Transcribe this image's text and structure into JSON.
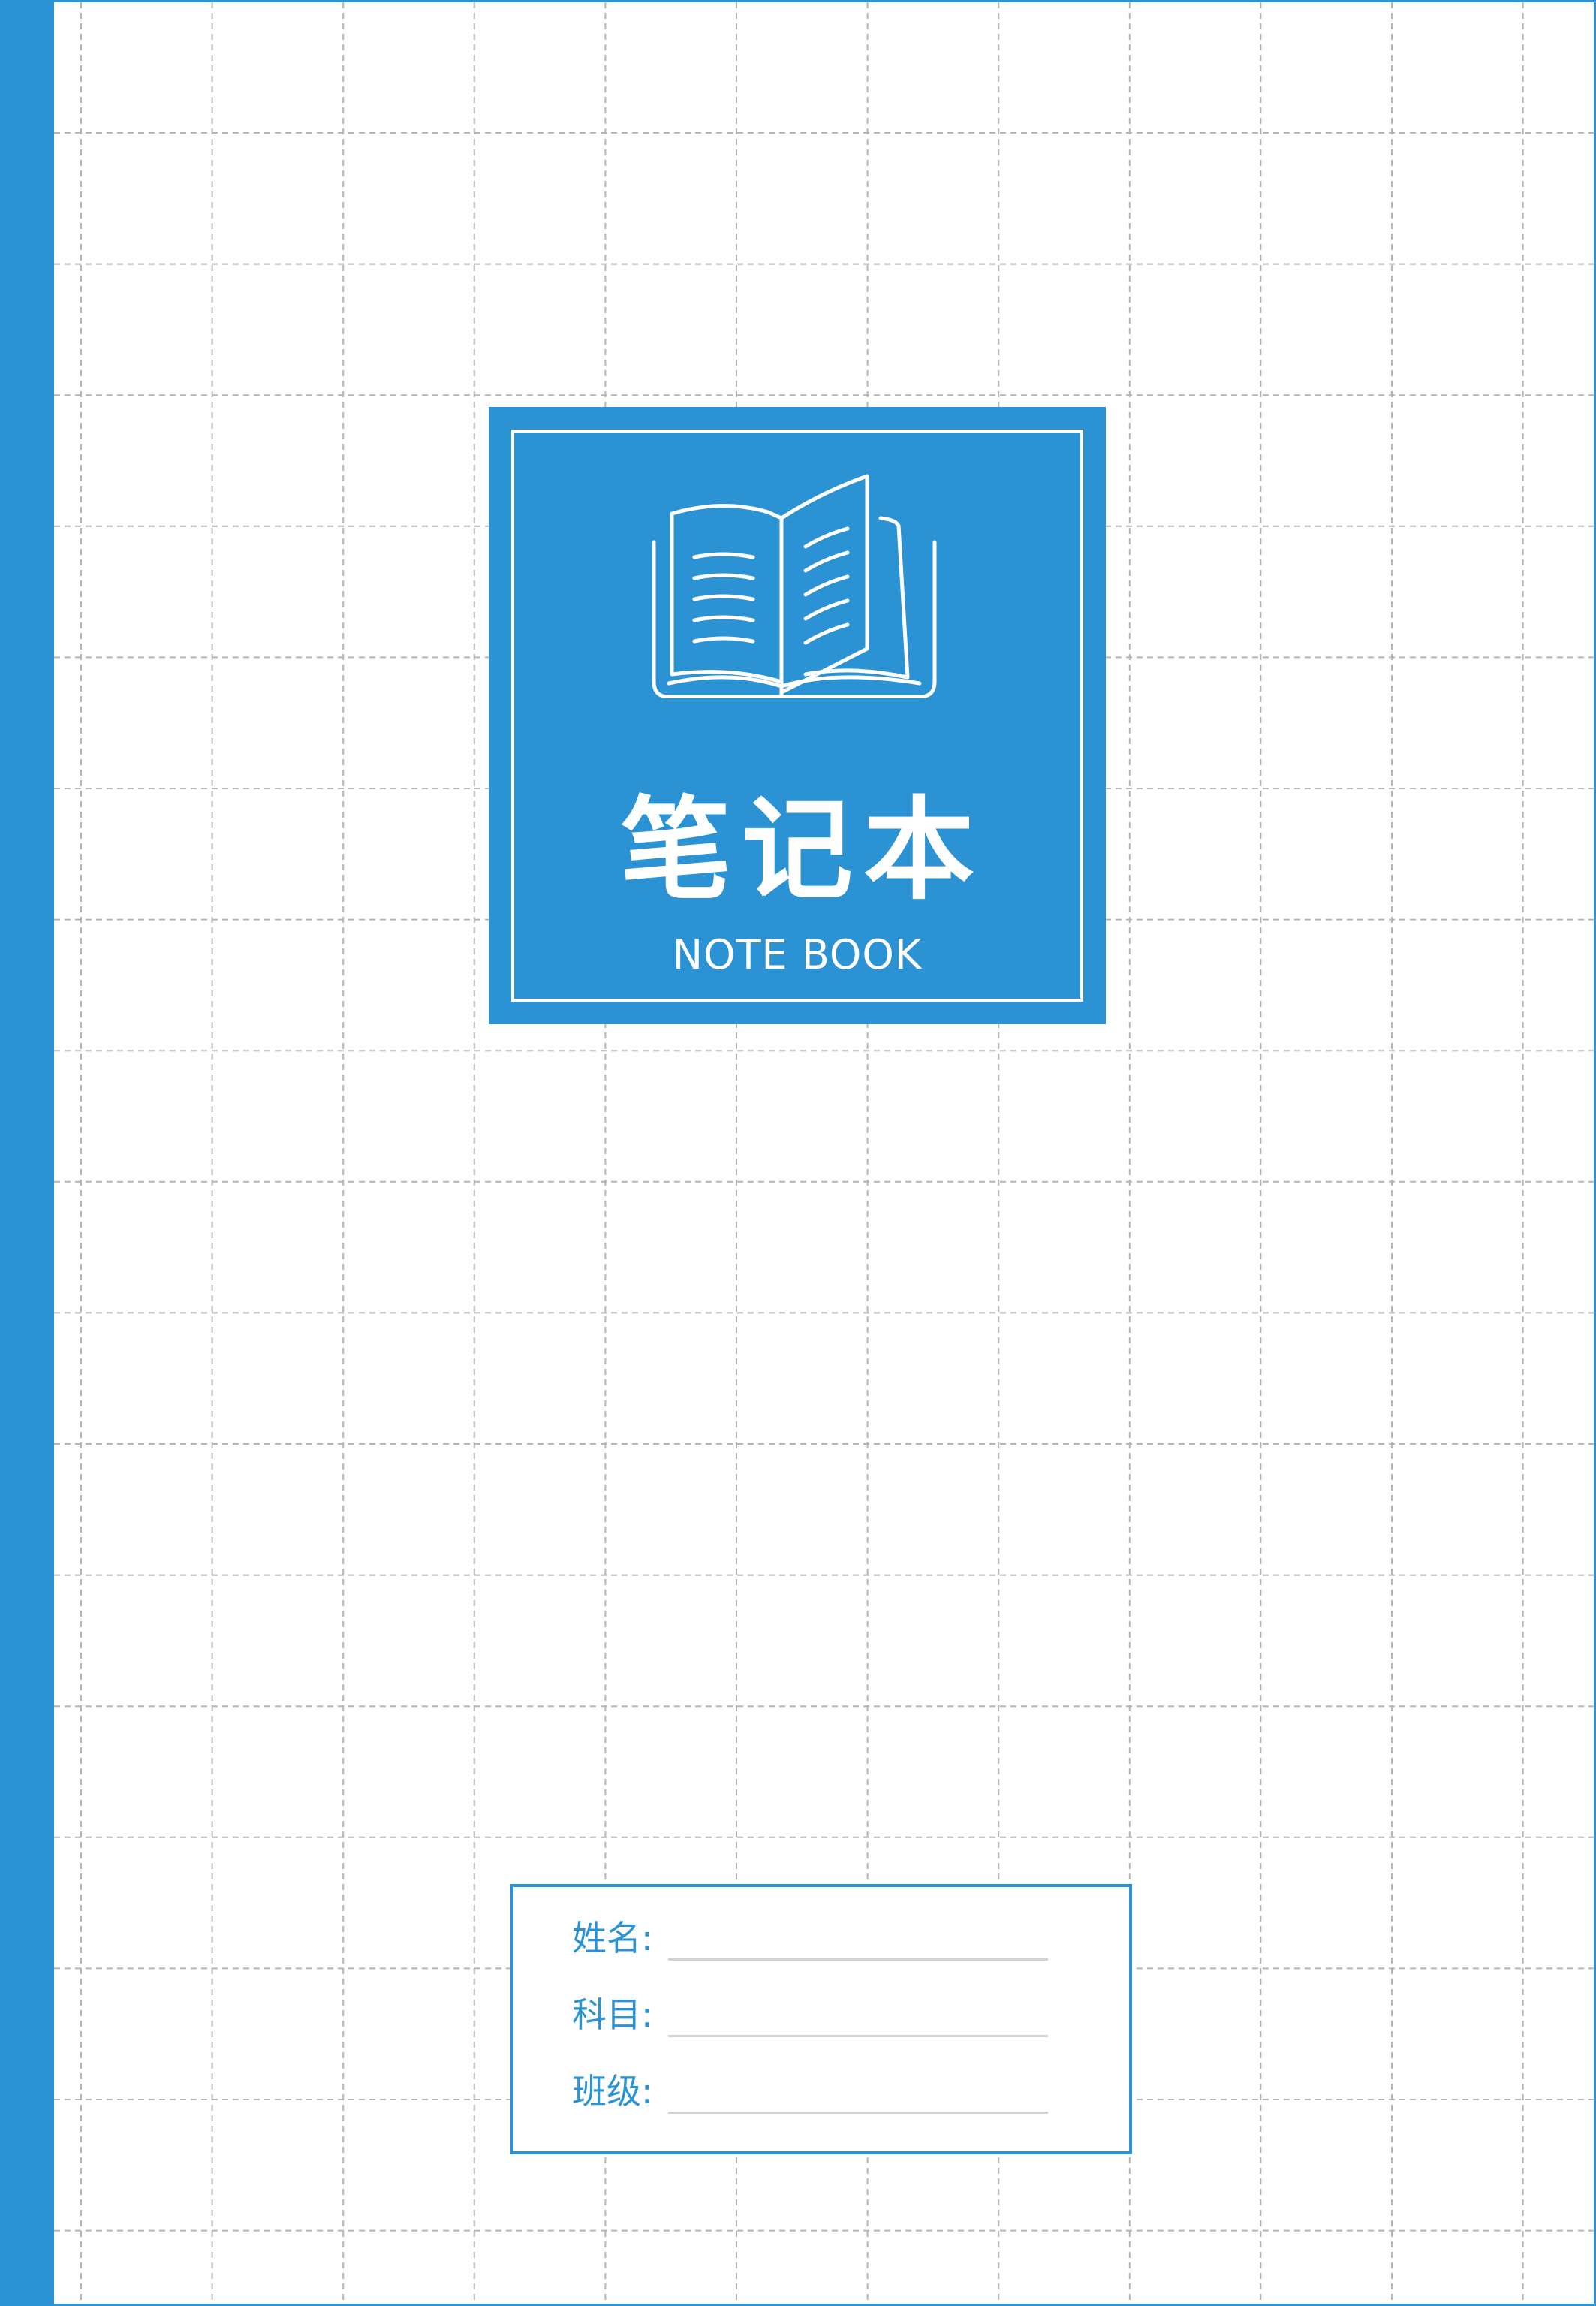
{
  "colors": {
    "accent": "#2b93d3",
    "grid": "#b5b5b5",
    "line": "#cfd3d6",
    "background": "#ffffff"
  },
  "cover": {
    "icon": "open-book-icon",
    "title_cn": "笔记本",
    "title_en": "NOTE BOOK"
  },
  "info": {
    "fields": [
      {
        "label": "姓名:",
        "value": ""
      },
      {
        "label": "科目:",
        "value": ""
      },
      {
        "label": "班级:",
        "value": ""
      }
    ]
  }
}
